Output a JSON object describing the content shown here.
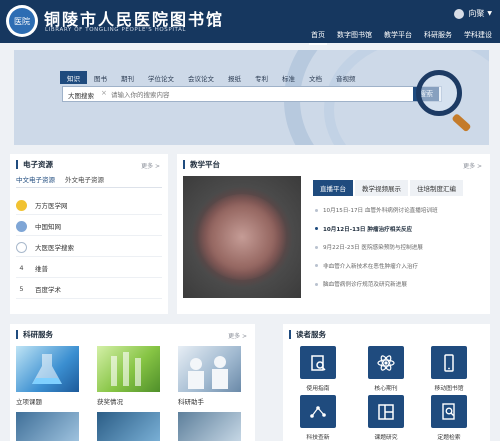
{
  "header": {
    "title": "铜陵市人民医院图书馆",
    "subtitle": "LIBRARY OF TONGLING PEOPLE'S HOSPITAL",
    "logo_text": "医院",
    "user_name": "向聚",
    "nav": [
      "首页",
      "数字图书馆",
      "教学平台",
      "科研服务",
      "学科建设"
    ]
  },
  "search": {
    "tabs": [
      "知识",
      "图书",
      "期刊",
      "学位论文",
      "会议论文",
      "报纸",
      "专利",
      "标准",
      "文档",
      "音视频"
    ],
    "scope": "大图搜索",
    "placeholder": "请输入你的搜索内容",
    "button": "搜索"
  },
  "e_resources": {
    "title": "电子资源",
    "more": "更多 >",
    "tabs": [
      "中文电子资源",
      "外文电子资源"
    ],
    "items": [
      {
        "label": "万方医学网",
        "icon": "gold-medal-icon"
      },
      {
        "label": "中国知网",
        "icon": "blue-medal-icon"
      },
      {
        "label": "大医医学搜索",
        "icon": "medal-icon"
      },
      {
        "label": "维普",
        "rank": "4"
      },
      {
        "label": "百度学术",
        "rank": "5"
      }
    ]
  },
  "teaching": {
    "title": "教学平台",
    "more": "更多 >",
    "tabs": [
      "直播平台",
      "教学视频展示",
      "住培制度汇编"
    ],
    "items": [
      "10月15日-17日 血管外科病例讨论直播培训班",
      "10月12日-13日 肿瘤治疗相关反应",
      "9月22日-23日 医院感染预防与控制进展",
      "非血管介入新技术在恶性肿瘤介入治疗",
      "脑血管病例诊疗规范及研究新进展"
    ]
  },
  "research": {
    "title": "科研服务",
    "more": "更多 >",
    "items": [
      "立项课题",
      "获奖情况",
      "科研助手"
    ]
  },
  "reader": {
    "title": "读者服务",
    "items": [
      {
        "label": "使用指南",
        "icon": "guide-icon"
      },
      {
        "label": "核心期刊",
        "icon": "atom-icon"
      },
      {
        "label": "移动图书馆",
        "icon": "mobile-icon"
      },
      {
        "label": "科技查新",
        "icon": "network-icon"
      },
      {
        "label": "课题研究",
        "icon": "layout-icon"
      },
      {
        "label": "定题检索",
        "icon": "search-doc-icon"
      }
    ]
  }
}
